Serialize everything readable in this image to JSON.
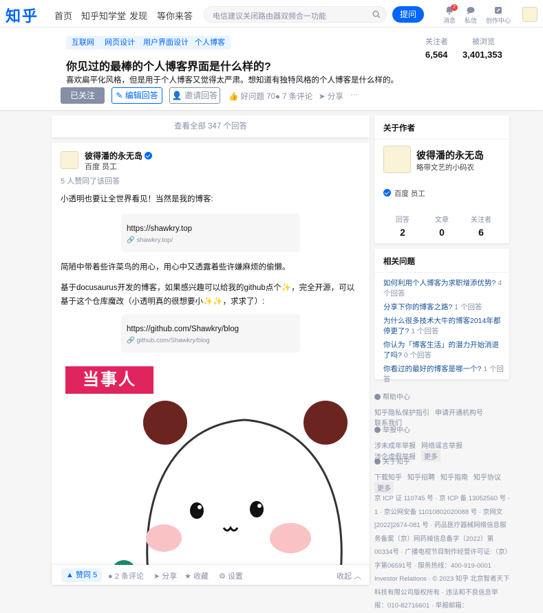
{
  "header": {
    "logo": "知乎",
    "nav": [
      "首页",
      "知乎知学堂",
      "发现",
      "等你来答"
    ],
    "search_placeholder": "电信建议关闭路由器双频合一功能",
    "ask_label": "提问",
    "icons": [
      {
        "label": "消息",
        "badge": "2",
        "icon": "bell-icon"
      },
      {
        "label": "私信",
        "icon": "chat-icon"
      },
      {
        "label": "创作中心",
        "icon": "creator-icon"
      }
    ]
  },
  "question": {
    "tags": [
      "互联网",
      "网页设计",
      "用户界面设计",
      "个人博客"
    ],
    "title": "你见过的最棒的个人博客界面是什么样的?",
    "description": "喜欢扁平化风格，但是用于个人博客又觉得太严肃。想知道有独特风格的个人博客是什么样的。",
    "followed_label": "已关注",
    "edit_answer_label": "编辑回答",
    "invite_label": "邀请回答",
    "good_question_label": "好问题 70",
    "comments_label": "7 条评论",
    "share_label": "分享",
    "more_label": "···",
    "followers_label": "关注者",
    "followers_value": "6,564",
    "views_label": "被浏览",
    "views_value": "3,401,353"
  },
  "answers": {
    "view_all_label": "查看全部 347 个回答"
  },
  "answer": {
    "author_name": "彼得潘的永无岛",
    "author_title": "百度 员工",
    "likers": "5 人赞同了该回答",
    "p1": "小透明也要让全世界看见！当然是我的博客:",
    "link1_title": "https://shawkry.top",
    "link1_url": "shawkry.top/",
    "p2": "简陋中带着些许菜鸟的用心，用心中又透露着些许嫌麻烦的偷懒。",
    "p3": "基于docusaurus开发的博客，如果感兴趣可以给我的github点个✨，完全开源，可以基于这个仓库魔改（小透明真的很想要小✨✨，求求了）:",
    "link2_title": "https://github.com/Shawkry/blog",
    "link2_url": "github.com/Shawkry/blog",
    "sticker_text": "当事人",
    "vote_label": "赞同 5",
    "comments_label": "2 条评论",
    "share_label": "分享",
    "collect_label": "收藏",
    "settings_label": "设置",
    "collapse_label": "收起"
  },
  "author_card": {
    "heading": "关于作者",
    "name": "彼得潘的永无岛",
    "bio": "略带文艺的小码农",
    "verify": "百度 员工",
    "stats": [
      {
        "label": "回答",
        "value": "2"
      },
      {
        "label": "文章",
        "value": "0"
      },
      {
        "label": "关注者",
        "value": "6"
      }
    ]
  },
  "related": {
    "heading": "相关问题",
    "items": [
      {
        "q": "如何利用个人博客为求职增添优势?",
        "count": "4 个回答"
      },
      {
        "q": "分享下你的博客之路?",
        "count": "1 个回答"
      },
      {
        "q": "为什么很多技术大牛的博客2014年都停更了?",
        "count": "1 个回答"
      },
      {
        "q": "你认为「博客生活」的潜力开始消退了吗?",
        "count": "0 个回答"
      },
      {
        "q": "你看过的最好的博客是哪一个?",
        "count": "1 个回答"
      }
    ]
  },
  "footer": {
    "help_heading": "帮助中心",
    "help_links": [
      "知乎隐私保护指引",
      "申请开通机构号",
      "联系我们"
    ],
    "report_heading": "举报中心",
    "report_links": [
      "涉未成年举报",
      "网络谣言举报",
      "涉企虚假举报"
    ],
    "report_more": "更多",
    "about_heading": "关于知乎",
    "about_links": [
      "下载知乎",
      "知乎招聘",
      "知乎指南",
      "知乎协议"
    ],
    "about_more": "更多",
    "legal": "京 ICP 证 110745 号 · 京 ICP 备 13052560 号 - 1 · 京公网安备 11010802020088 号 · 京网文[2022]2674-081 号 · 药品医疗器械网络信息服务备案（京）网药械信息备字（2022）第00334号 · 广播电视节目制作经营许可证:（京）字第06591号 · 服务热线：400-919-0001 · Investor Relations · © 2023 知乎 北京智者天下科技有限公司版权所有 · 违法和不良信息举报：010-82716601 · 举报邮箱："
  }
}
